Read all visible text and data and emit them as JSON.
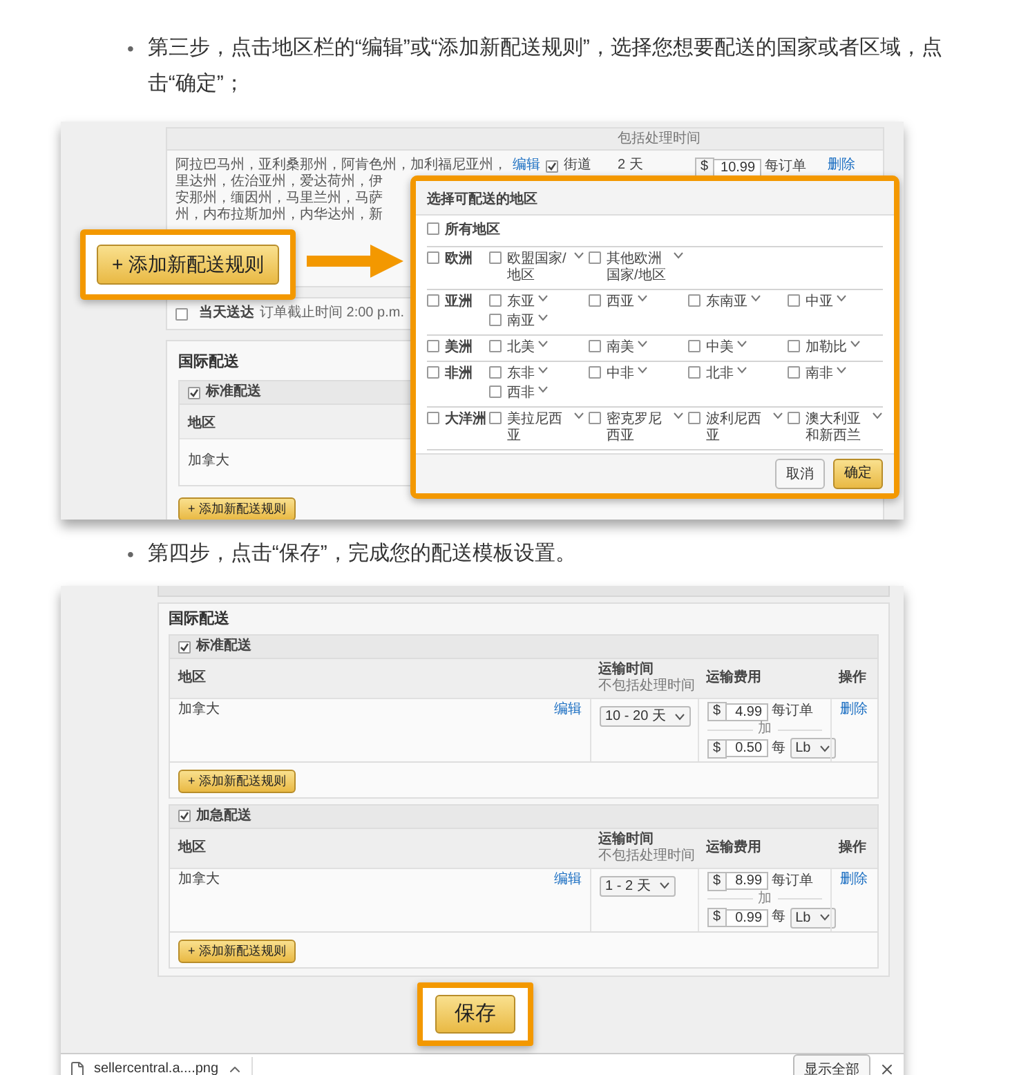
{
  "sections": [
    {
      "bullet": "•",
      "text": "第三步，点击地区栏的“编辑”或“添加新配送规则”，选择您想要配送的国家或者区域，点击“确定”；",
      "figure": {
        "kind": "region-dialog",
        "time_header": "包括处理时间",
        "row": {
          "region_lines": [
            "阿拉巴马州，亚利桑那州，阿肯色州，加利福尼亚州，",
            "里达州，佐治亚州，爱达荷州，伊",
            "安那州，缅因州，马里兰州，马萨",
            "州，内布拉斯加州，内华达州，新"
          ],
          "edit": "编辑",
          "address_types": [
            {
              "label": "街道",
              "checked": true
            }
          ],
          "time": "2 天",
          "currency": "$",
          "price": "10.99",
          "unit": "每订单",
          "delete": "删除"
        },
        "same_day": {
          "checked": false,
          "label": "当天送达",
          "cutoff": "订单截止时间 2:00 p.m."
        },
        "international": {
          "title": "国际配送",
          "group": {
            "label": "标准配送",
            "checked": true
          },
          "region_header": "地区",
          "region": "加拿大",
          "add_button": "+ 添加新配送规则"
        },
        "callout_button": "+ 添加新配送规则",
        "dialog": {
          "title": "选择可配送的地区",
          "all": {
            "label": "所有地区",
            "checked": false
          },
          "groups": [
            {
              "label": "欧洲",
              "checked": false,
              "regions": [
                {
                  "label": "欧盟国家/地区",
                  "checked": false
                },
                {
                  "label": "其他欧洲国家/地区",
                  "checked": false
                }
              ]
            },
            {
              "label": "亚洲",
              "checked": false,
              "regions": [
                {
                  "label": "东亚",
                  "checked": false
                },
                {
                  "label": "西亚",
                  "checked": false
                },
                {
                  "label": "东南亚",
                  "checked": false
                },
                {
                  "label": "中亚",
                  "checked": false
                },
                {
                  "label": "南亚",
                  "checked": false
                }
              ]
            },
            {
              "label": "美洲",
              "checked": false,
              "regions": [
                {
                  "label": "北美",
                  "checked": false
                },
                {
                  "label": "南美",
                  "checked": false
                },
                {
                  "label": "中美",
                  "checked": false
                },
                {
                  "label": "加勒比",
                  "checked": false
                }
              ]
            },
            {
              "label": "非洲",
              "checked": false,
              "regions": [
                {
                  "label": "东非",
                  "checked": false
                },
                {
                  "label": "中非",
                  "checked": false
                },
                {
                  "label": "北非",
                  "checked": false
                },
                {
                  "label": "南非",
                  "checked": false
                },
                {
                  "label": "西非",
                  "checked": false
                }
              ]
            },
            {
              "label": "大洋洲",
              "checked": false,
              "regions": [
                {
                  "label": "美拉尼西亚",
                  "checked": false
                },
                {
                  "label": "密克罗尼西亚",
                  "checked": false
                },
                {
                  "label": "波利尼西亚",
                  "checked": false
                },
                {
                  "label": "澳大利亚和新西兰",
                  "checked": false
                }
              ]
            }
          ],
          "buttons": [
            {
              "label": "取消",
              "kind": "secondary"
            },
            {
              "label": "确定",
              "kind": "primary"
            }
          ]
        }
      }
    },
    {
      "bullet": "•",
      "text": "第四步，点击“保存”，完成您的配送模板设置。",
      "figure": {
        "kind": "save-page",
        "title": "国际配送",
        "groups": [
          {
            "label": "标准配送",
            "checked": true,
            "columns": {
              "region": "地区",
              "time": "运输时间",
              "time_note": "不包括处理时间",
              "fee": "运输费用",
              "ops": "操作"
            },
            "rows": [
              {
                "region": "加拿大",
                "edit": "编辑",
                "time": "10 - 20 天",
                "currency": "$",
                "order_fee": "4.99",
                "order_unit": "每订单",
                "plus": "加",
                "weight_currency": "$",
                "weight_fee": "0.50",
                "weight_unit": "每",
                "unit_select": "Lb",
                "delete": "删除"
              }
            ],
            "add_button": "+ 添加新配送规则"
          },
          {
            "label": "加急配送",
            "checked": true,
            "columns": {
              "region": "地区",
              "time": "运输时间",
              "time_note": "不包括处理时间",
              "fee": "运输费用",
              "ops": "操作"
            },
            "rows": [
              {
                "region": "加拿大",
                "edit": "编辑",
                "time": "1 - 2 天",
                "currency": "$",
                "order_fee": "8.99",
                "order_unit": "每订单",
                "plus": "加",
                "weight_currency": "$",
                "weight_fee": "0.99",
                "weight_unit": "每",
                "unit_select": "Lb",
                "delete": "删除"
              }
            ],
            "add_button": "+ 添加新配送规则"
          }
        ],
        "save_button": "保存",
        "download": {
          "file": "sellercentral.a....png",
          "show_all": "显示全部"
        }
      }
    }
  ]
}
